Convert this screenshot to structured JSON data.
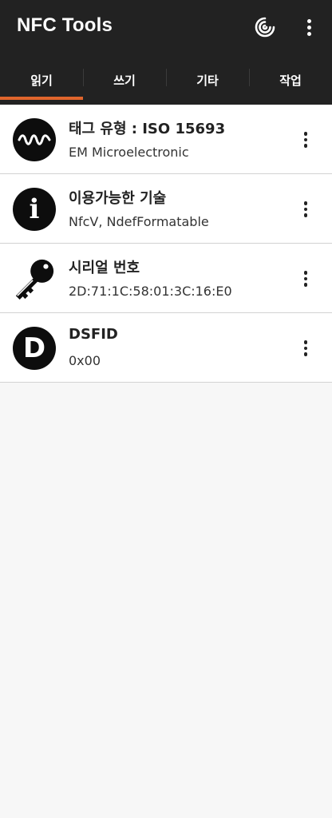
{
  "app": {
    "title": "NFC Tools"
  },
  "toolbar": {
    "nfc_icon": "nfc-icon",
    "more_icon": "more-vert-icon"
  },
  "tabs": [
    {
      "label": "읽기",
      "active": true
    },
    {
      "label": "쓰기",
      "active": false
    },
    {
      "label": "기타",
      "active": false
    },
    {
      "label": "작업",
      "active": false
    }
  ],
  "items": [
    {
      "icon": "wave-icon",
      "title": "태그 유형 : ISO 15693",
      "subtitle": "EM Microelectronic"
    },
    {
      "icon": "info-icon",
      "glyph": "i",
      "title": "이용가능한 기술",
      "subtitle": "NfcV, NdefFormatable"
    },
    {
      "icon": "key-icon",
      "title": "시리얼 번호",
      "subtitle": "2D:71:1C:58:01:3C:16:E0"
    },
    {
      "icon": "dsfid-icon",
      "glyph": "D",
      "title": "DSFID",
      "subtitle": "0x00"
    }
  ],
  "colors": {
    "appbar": "#222222",
    "accent": "#e0652c",
    "background": "#f7f7f7",
    "card": "#ffffff"
  }
}
